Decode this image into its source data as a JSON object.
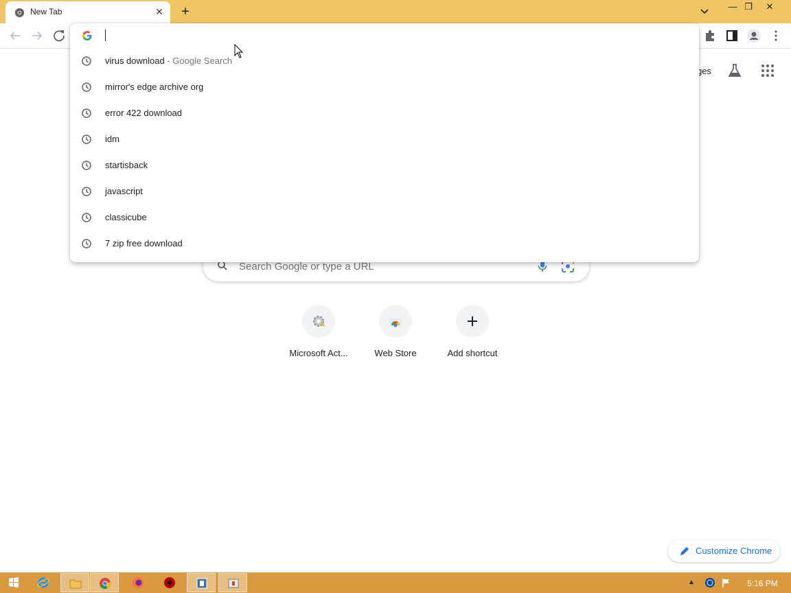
{
  "tabs": [
    {
      "title": "New Tab",
      "close_label": "✕"
    }
  ],
  "new_tab_label": "+",
  "window_controls": {
    "minimize": "—",
    "maximize": "❐",
    "close": "✕"
  },
  "omnibox": {
    "value": "",
    "suggestions": [
      {
        "text": "virus download",
        "sub": " - Google Search",
        "icon": "history-icon"
      },
      {
        "text": "mirror's edge archive org",
        "sub": "",
        "icon": "history-icon"
      },
      {
        "text": "error 422 download",
        "sub": "",
        "icon": "history-icon"
      },
      {
        "text": "idm",
        "sub": "",
        "icon": "history-icon"
      },
      {
        "text": "startisback",
        "sub": "",
        "icon": "history-icon"
      },
      {
        "text": "javascript",
        "sub": "",
        "icon": "history-icon"
      },
      {
        "text": "classicube",
        "sub": "",
        "icon": "history-icon"
      },
      {
        "text": "7 zip free download",
        "sub": "",
        "icon": "history-icon"
      }
    ]
  },
  "ntp": {
    "top_links_partial": "ges",
    "search_placeholder": "Search Google or type a URL",
    "shortcuts": [
      {
        "label": "Microsoft Act...",
        "icon": "gear-icon"
      },
      {
        "label": "Web Store",
        "icon": "webstore-icon"
      },
      {
        "label": "Add shortcut",
        "icon": "plus-icon"
      }
    ],
    "customize_label": "Customize Chrome"
  },
  "taskbar": {
    "clock": "5:16 PM",
    "tray_up": "▲"
  },
  "colors": {
    "tabstrip": "#f0c564",
    "taskbar": "#d99a3f",
    "accent_blue": "#1a73e8"
  }
}
